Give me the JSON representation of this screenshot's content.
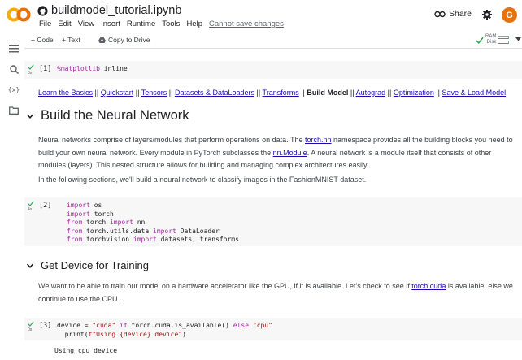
{
  "header": {
    "notebook_title": "buildmodel_tutorial.ipynb",
    "menu": [
      "File",
      "Edit",
      "View",
      "Insert",
      "Runtime",
      "Tools",
      "Help"
    ],
    "save_warning": "Cannot save changes",
    "share_label": "Share",
    "avatar_letter": "G"
  },
  "toolbar": {
    "code_label": "+ Code",
    "text_label": "+ Text",
    "copy_label": "Copy to Drive",
    "ram_label": "RAM",
    "disk_label": "Disk"
  },
  "cells": {
    "c1": {
      "prompt": "[1]",
      "code": "%matplotlib inline",
      "secs": "0s"
    },
    "c2": {
      "prompt": "[2]",
      "secs": "4s",
      "lines": [
        "import os",
        "import torch",
        "from torch import nn",
        "from torch.utils.data import DataLoader",
        "from torchvision import datasets, transforms"
      ]
    },
    "c3": {
      "prompt": "[3]",
      "secs": "0s",
      "lines": [
        "device = \"cuda\" if torch.cuda.is_available() else \"cpu\"",
        "print(f\"Using {device} device\")"
      ],
      "output": "Using cpu device"
    }
  },
  "nav": {
    "basics": "Learn the Basics",
    "quickstart": "Quickstart",
    "tensors": "Tensors",
    "datasets": "Datasets & DataLoaders",
    "transforms": "Transforms",
    "build": "Build Model",
    "autograd": "Autograd",
    "optimization": "Optimization",
    "save": "Save & Load Model",
    "sep": " || "
  },
  "section1": {
    "title": "Build the Neural Network",
    "p1_a": "Neural networks comprise of layers/modules that perform operations on data. The ",
    "p1_link1": "torch.nn",
    "p1_b": " namespace provides all the building blocks you need to build your own neural network. Every module in PyTorch subclasses the ",
    "p1_link2": "nn.Module",
    "p1_c": ". A neural network is a module itself that consists of other modules (layers). This nested structure allows for building and managing complex architectures easily.",
    "p2": "In the following sections, we'll build a neural network to classify images in the FashionMNIST dataset."
  },
  "section2": {
    "title": "Get Device for Training",
    "p1_a": "We want to be able to train our model on a hardware accelerator like the GPU, if it is available. Let's check to see if ",
    "p1_link": "torch.cuda",
    "p1_b": " is available, else we continue to use the CPU."
  },
  "colors": {
    "link": "#1a0dab",
    "check": "#34a853",
    "keyword": "#a626a4",
    "string": "#a31515",
    "avatar": "#e8710a"
  }
}
